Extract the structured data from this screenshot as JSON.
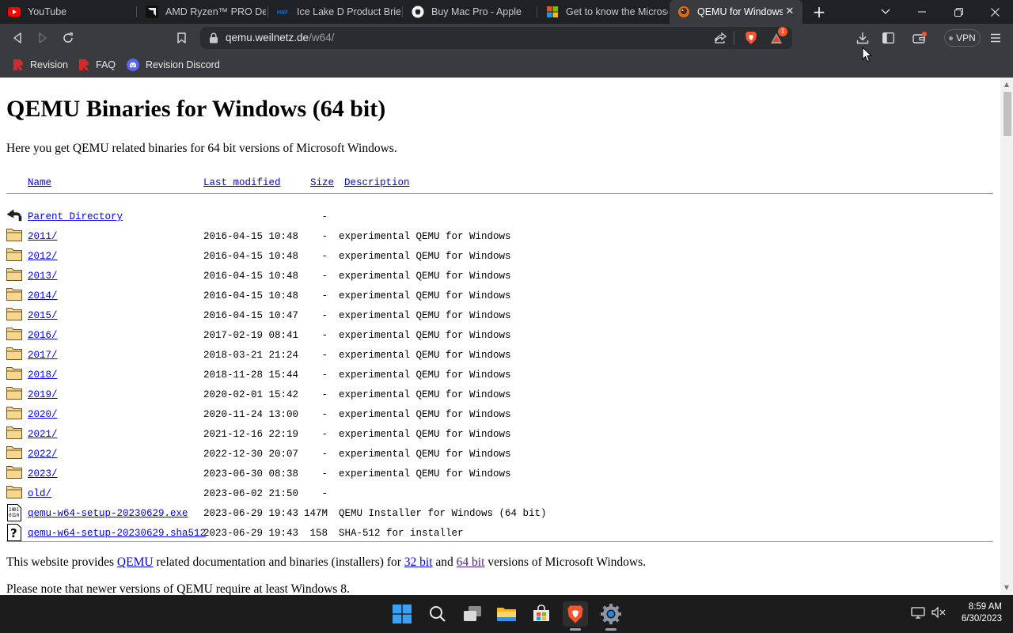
{
  "browser": {
    "tabs": [
      {
        "title": "YouTube",
        "icon": "youtube-icon",
        "active": false
      },
      {
        "title": "AMD Ryzen™ PRO Deskt",
        "icon": "amd-icon",
        "active": false
      },
      {
        "title": "Ice Lake D Product Brief",
        "icon": "intel-icon",
        "active": false
      },
      {
        "title": "Buy Mac Pro - Apple",
        "icon": "apple-icon",
        "active": false
      },
      {
        "title": "Get to know the Microsc",
        "icon": "microsoft-icon",
        "active": false
      },
      {
        "title": "QEMU for Windows",
        "icon": "qemu-icon",
        "active": true
      }
    ],
    "url": {
      "host": "qemu.weilnetz.de",
      "path": "/w64/"
    },
    "vpn_label": "VPN",
    "notification_count": "1",
    "bookmarks": [
      {
        "label": "Revision",
        "icon": "revision-icon"
      },
      {
        "label": "FAQ",
        "icon": "revision-icon"
      },
      {
        "label": "Revision Discord",
        "icon": "discord-icon"
      }
    ]
  },
  "page": {
    "title": "QEMU Binaries for Windows (64 bit)",
    "intro": "Here you get QEMU related binaries for 64 bit versions of Microsoft Windows.",
    "columns": {
      "name": "Name",
      "last_modified": "Last modified",
      "size": "Size",
      "description": "Description"
    },
    "entries": [
      {
        "name": "Parent Directory",
        "date": "",
        "size": "-",
        "desc": "",
        "icon": "back-icon"
      },
      {
        "name": "2011/",
        "date": "2016-04-15 10:48",
        "size": "-",
        "desc": "experimental QEMU for Windows",
        "icon": "folder-icon"
      },
      {
        "name": "2012/",
        "date": "2016-04-15 10:48",
        "size": "-",
        "desc": "experimental QEMU for Windows",
        "icon": "folder-icon"
      },
      {
        "name": "2013/",
        "date": "2016-04-15 10:48",
        "size": "-",
        "desc": "experimental QEMU for Windows",
        "icon": "folder-icon"
      },
      {
        "name": "2014/",
        "date": "2016-04-15 10:48",
        "size": "-",
        "desc": "experimental QEMU for Windows",
        "icon": "folder-icon"
      },
      {
        "name": "2015/",
        "date": "2016-04-15 10:47",
        "size": "-",
        "desc": "experimental QEMU for Windows",
        "icon": "folder-icon"
      },
      {
        "name": "2016/",
        "date": "2017-02-19 08:41",
        "size": "-",
        "desc": "experimental QEMU for Windows",
        "icon": "folder-icon"
      },
      {
        "name": "2017/",
        "date": "2018-03-21 21:24",
        "size": "-",
        "desc": "experimental QEMU for Windows",
        "icon": "folder-icon"
      },
      {
        "name": "2018/",
        "date": "2018-11-28 15:44",
        "size": "-",
        "desc": "experimental QEMU for Windows",
        "icon": "folder-icon"
      },
      {
        "name": "2019/",
        "date": "2020-02-01 15:42",
        "size": "-",
        "desc": "experimental QEMU for Windows",
        "icon": "folder-icon"
      },
      {
        "name": "2020/",
        "date": "2020-11-24 13:00",
        "size": "-",
        "desc": "experimental QEMU for Windows",
        "icon": "folder-icon"
      },
      {
        "name": "2021/",
        "date": "2021-12-16 22:19",
        "size": "-",
        "desc": "experimental QEMU for Windows",
        "icon": "folder-icon"
      },
      {
        "name": "2022/",
        "date": "2022-12-30 20:07",
        "size": "-",
        "desc": "experimental QEMU for Windows",
        "icon": "folder-icon"
      },
      {
        "name": "2023/",
        "date": "2023-06-30 08:38",
        "size": "-",
        "desc": "experimental QEMU for Windows",
        "icon": "folder-icon"
      },
      {
        "name": "old/",
        "date": "2023-06-02 21:50",
        "size": "-",
        "desc": "",
        "icon": "folder-icon"
      },
      {
        "name": "qemu-w64-setup-20230629.exe",
        "date": "2023-06-29 19:43",
        "size": "147M",
        "desc": "QEMU Installer for Windows (64 bit)",
        "icon": "binary-file-icon"
      },
      {
        "name": "qemu-w64-setup-20230629.sha512",
        "date": "2023-06-29 19:43",
        "size": "158",
        "desc": "SHA-512 for installer",
        "icon": "unknown-file-icon"
      }
    ],
    "footer1": {
      "t1": "This website provides ",
      "link1": "QEMU",
      "t2": " related documentation and binaries (installers) for ",
      "link2": "32 bit",
      "t3": " and ",
      "link3": "64 bit",
      "t4": " versions of Microsoft Windows."
    },
    "footer2": "Please note that newer versions of QEMU require at least Windows 8."
  },
  "taskbar": {
    "apps": [
      "windows-start-icon",
      "search-icon",
      "task-view-icon",
      "file-explorer-icon",
      "microsoft-store-icon",
      "brave-browser-icon",
      "settings-icon"
    ],
    "time": "8:59 AM",
    "date": "6/30/2023"
  },
  "colors": {
    "link": "#0000ee",
    "visited_link": "#551a8b",
    "brave_orange": "#fb542b"
  }
}
